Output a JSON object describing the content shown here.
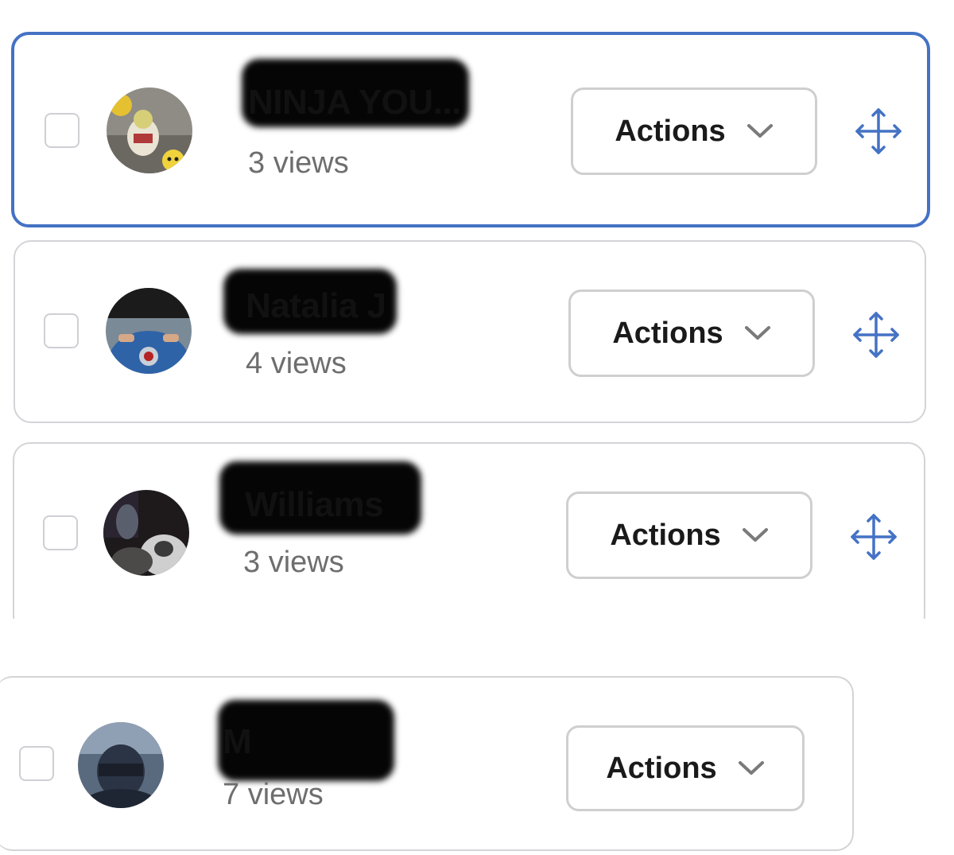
{
  "colors": {
    "accent": "#4472c4",
    "border": "#d4d4d8",
    "views_text": "#6e6e6e"
  },
  "items": [
    {
      "name": "NINJA YOU...",
      "views": "3 views",
      "actions_label": "Actions",
      "selected": true,
      "has_move": true
    },
    {
      "name": "Natalia J",
      "views": "4 views",
      "actions_label": "Actions",
      "selected": false,
      "has_move": true
    },
    {
      "name": "Williams",
      "views": "3 views",
      "actions_label": "Actions",
      "selected": false,
      "has_move": true
    },
    {
      "name": "M",
      "views": "7 views",
      "actions_label": "Actions",
      "selected": false,
      "has_move": false
    }
  ],
  "icons": {
    "chevron": "chevron-down-icon",
    "move": "move-arrows-icon"
  }
}
